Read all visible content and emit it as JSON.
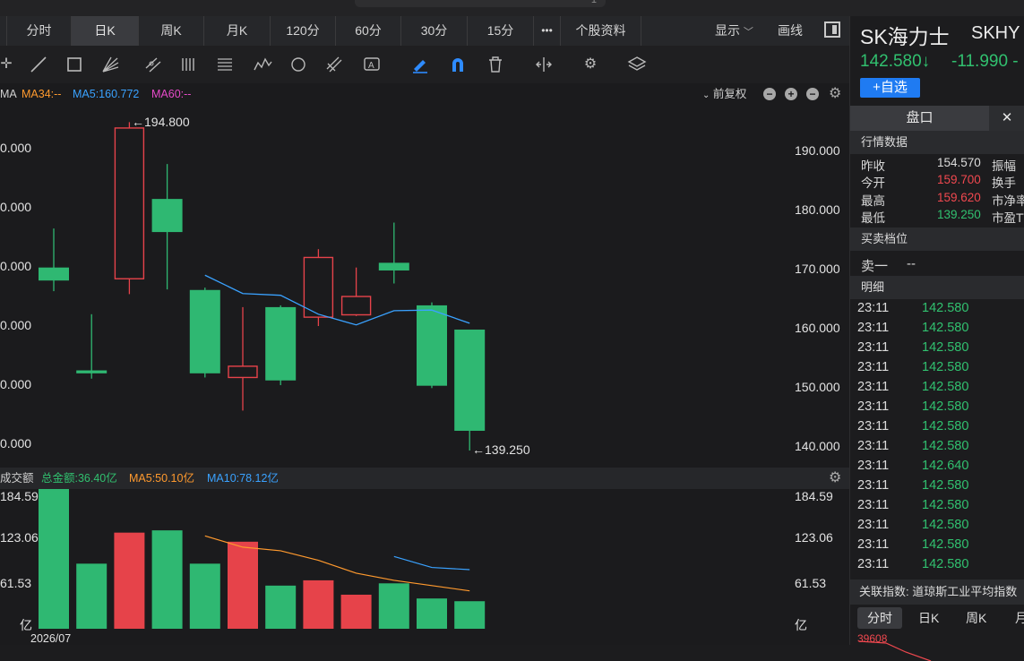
{
  "window": {
    "handle_glyph": "1"
  },
  "toolbar": {
    "tabs": [
      {
        "label": "分时",
        "active": false
      },
      {
        "label": "日K",
        "active": true
      },
      {
        "label": "周K",
        "active": false
      },
      {
        "label": "月K",
        "active": false
      },
      {
        "label": "120分",
        "active": false
      },
      {
        "label": "60分",
        "active": false
      },
      {
        "label": "30分",
        "active": false
      },
      {
        "label": "15分",
        "active": false
      },
      {
        "label": "•••",
        "active": false
      },
      {
        "label": "个股资料",
        "active": false
      }
    ],
    "display_label": "显示",
    "draw_label": "画线",
    "icons": [
      "crosshair-icon",
      "line-icon",
      "rect-icon",
      "fan-icon",
      "channel-icon",
      "bars-icon",
      "text-list-icon",
      "wave-icon",
      "cycle-icon",
      "fib-icon",
      "label-icon",
      "pen-icon",
      "magnet-icon",
      "trash-icon",
      "split-icon",
      "settings-icon",
      "layers-icon"
    ]
  },
  "ma_line": {
    "prefix": "MA",
    "ma34": "MA34:--",
    "ma5": "MA5:160.772",
    "ma60": "MA60:--",
    "adjust_label": "前复权",
    "colors": {
      "ma34": "#ff9a2e",
      "ma5": "#3aa2ff",
      "ma60": "#e64ac8"
    }
  },
  "price_axis": {
    "left_labels": [
      "0.000",
      "0.000",
      "0.000",
      "0.000",
      "0.000",
      "0.000"
    ],
    "right_labels": [
      "190.000",
      "180.000",
      "170.000",
      "160.000",
      "150.000",
      "140.000"
    ]
  },
  "annotations": {
    "high": "←194.800",
    "low": "←139.250"
  },
  "volume_header": {
    "title": "成交额",
    "total": "总金额:36.40亿",
    "ma5": "MA5:50.10亿",
    "ma10": "MA10:78.12亿"
  },
  "volume_axis": {
    "left_labels": [
      "184.59",
      "123.06",
      "61.53",
      "亿"
    ],
    "right_labels": [
      "184.59",
      "123.06",
      "61.53",
      "亿"
    ]
  },
  "date_label": "2026/07",
  "chart_data": [
    {
      "type": "candlestick",
      "ylim": [
        136,
        197
      ],
      "candles": [
        {
          "o": 170.2,
          "h": 176.8,
          "l": 166.2,
          "c": 168.0
        },
        {
          "o": 152.8,
          "h": 162.3,
          "l": 151.4,
          "c": 152.3
        },
        {
          "o": 168.3,
          "h": 194.8,
          "l": 165.7,
          "c": 193.8
        },
        {
          "o": 181.8,
          "h": 187.7,
          "l": 166.5,
          "c": 176.2
        },
        {
          "o": 166.4,
          "h": 166.8,
          "l": 151.6,
          "c": 152.3
        },
        {
          "o": 151.6,
          "h": 163.5,
          "l": 146.0,
          "c": 153.5
        },
        {
          "o": 163.5,
          "h": 163.8,
          "l": 150.3,
          "c": 151.1
        },
        {
          "o": 161.8,
          "h": 173.3,
          "l": 160.3,
          "c": 171.9
        },
        {
          "o": 162.2,
          "h": 170.2,
          "l": 162.0,
          "c": 165.3
        },
        {
          "o": 171.0,
          "h": 177.8,
          "l": 167.5,
          "c": 169.7
        },
        {
          "o": 163.8,
          "h": 164.3,
          "l": 149.8,
          "c": 150.2
        },
        {
          "o": 159.7,
          "h": 159.6,
          "l": 139.25,
          "c": 142.58
        }
      ],
      "ma5": [
        null,
        null,
        null,
        null,
        168.9,
        165.8,
        165.5,
        162.3,
        160.5,
        162.9,
        163.0,
        160.77
      ]
    },
    {
      "type": "bar",
      "unit": "亿",
      "ylim": [
        0,
        184.59
      ],
      "values": [
        184.59,
        86.0,
        127.0,
        130.0,
        86.0,
        115.0,
        57.0,
        64.0,
        45.0,
        60.0,
        40.0,
        36.4
      ],
      "up": [
        false,
        false,
        true,
        false,
        false,
        true,
        false,
        true,
        true,
        false,
        false,
        false
      ],
      "ma5": [
        null,
        null,
        null,
        null,
        122.7,
        107.8,
        103.0,
        90.4,
        73.4,
        64.0,
        57.0,
        50.1
      ],
      "ma10": [
        null,
        null,
        null,
        null,
        null,
        null,
        null,
        null,
        null,
        95.5,
        81.0,
        78.12
      ]
    }
  ],
  "right_panel": {
    "name": "SK海力士",
    "code": "SKHY",
    "price": "142.580↓",
    "change": "-11.990 -",
    "add_button": "+自选",
    "tab_label": "盘口",
    "close_glyph": "✕",
    "quote_section": "行情数据",
    "quotes": [
      {
        "label": "昨收",
        "value": "154.570",
        "color": "neutral",
        "label2": "振幅"
      },
      {
        "label": "今开",
        "value": "159.700",
        "color": "red",
        "label2": "换手"
      },
      {
        "label": "最高",
        "value": "159.620",
        "color": "red",
        "label2": "市净率"
      },
      {
        "label": "最低",
        "value": "139.250",
        "color": "green",
        "label2": "市盈TT"
      }
    ],
    "orderbook_section": "买卖档位",
    "ask1_label": "卖一",
    "ask1_value": "--",
    "detail_section": "明细",
    "details": [
      {
        "time": "23:11",
        "price": "142.580"
      },
      {
        "time": "23:11",
        "price": "142.580"
      },
      {
        "time": "23:11",
        "price": "142.580"
      },
      {
        "time": "23:11",
        "price": "142.580"
      },
      {
        "time": "23:11",
        "price": "142.580"
      },
      {
        "time": "23:11",
        "price": "142.580"
      },
      {
        "time": "23:11",
        "price": "142.580"
      },
      {
        "time": "23:11",
        "price": "142.580"
      },
      {
        "time": "23:11",
        "price": "142.640"
      },
      {
        "time": "23:11",
        "price": "142.580"
      },
      {
        "time": "23:11",
        "price": "142.580"
      },
      {
        "time": "23:11",
        "price": "142.580"
      },
      {
        "time": "23:11",
        "price": "142.580"
      },
      {
        "time": "23:11",
        "price": "142.580"
      }
    ],
    "index_label": "关联指数:",
    "index_name": "道琼斯工业平均指数",
    "bottom_tabs": [
      "分时",
      "日K",
      "周K",
      "月"
    ],
    "bottom_value": "39608"
  }
}
